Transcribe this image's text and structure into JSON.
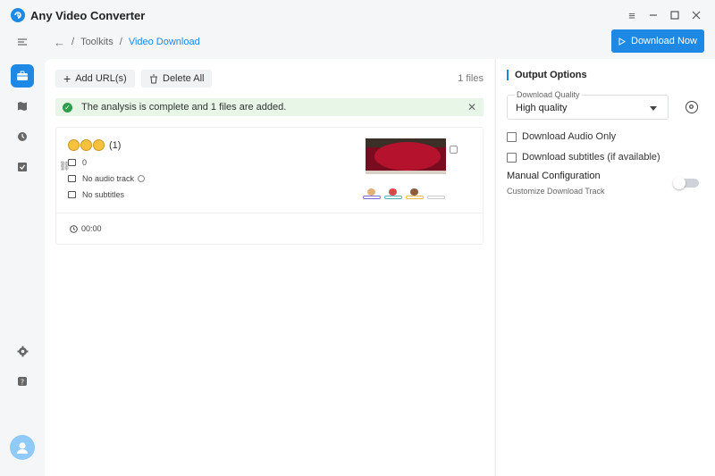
{
  "app": {
    "title": "Any Video Converter"
  },
  "breadcrumb": {
    "parent": "Toolkits",
    "separator": "/",
    "current": "Video Download"
  },
  "header": {
    "download_now_label": "Download Now"
  },
  "toolbar": {
    "add_url_label": "Add URL(s)",
    "delete_all_label": "Delete All",
    "file_count": "1 files"
  },
  "notice": {
    "text": "The analysis is complete and 1 files are added.",
    "type": "success"
  },
  "file_item": {
    "title_suffix": "(1)",
    "video_tracks": "0",
    "audio": "No audio track",
    "subtitles": "No subtitles",
    "duration": "00:00"
  },
  "output_options": {
    "title": "Output Options",
    "quality_label": "Download Quality",
    "quality_value": "High quality",
    "audio_only_label": "Download Audio Only",
    "audio_only_checked": false,
    "subtitles_label": "Download subtitles (if available)",
    "subtitles_checked": false,
    "manual_config_label": "Manual Configuration",
    "manual_config_sub": "Customize Download Track",
    "manual_config_enabled": false
  },
  "colors": {
    "accent": "#1e88e5",
    "success_bg": "#e8f6e8",
    "success_icon": "#2e9e4a"
  },
  "icons": {
    "sidebar": [
      "menu-icon",
      "toolkit-icon",
      "library-icon",
      "history-icon",
      "tasks-icon",
      "settings-icon",
      "help-icon",
      "avatar-icon"
    ],
    "window": [
      "hamburger-icon",
      "minimize-icon",
      "maximize-icon",
      "close-icon"
    ]
  }
}
